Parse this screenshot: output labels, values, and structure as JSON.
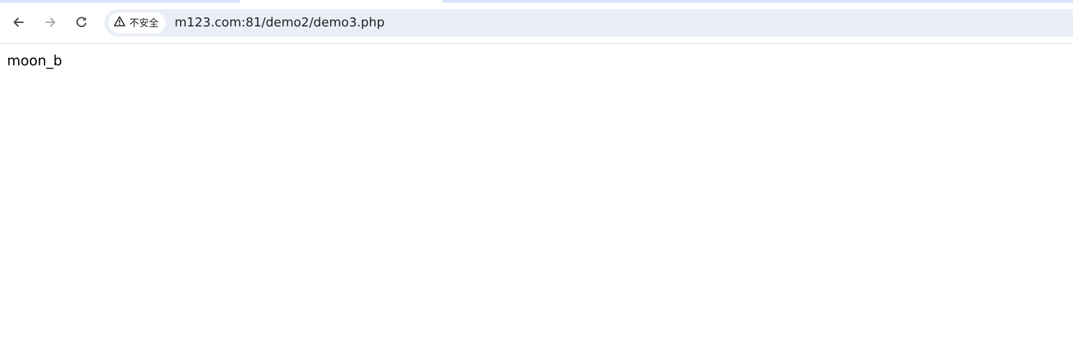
{
  "browser": {
    "toolbar": {
      "back_icon": "arrow-left-icon",
      "forward_icon": "arrow-right-icon",
      "reload_icon": "reload-icon"
    },
    "omnibox": {
      "security_icon": "warning-triangle-icon",
      "security_label": "不安全",
      "url": "m123.com:81/demo2/demo3.php"
    },
    "colors": {
      "tabstrip_accent": "#d3e3fd",
      "omnibox_background": "#eaeef7",
      "icon_active": "#474747",
      "icon_disabled": "#a8a8a8"
    }
  },
  "page": {
    "body_text": "moon_b"
  }
}
